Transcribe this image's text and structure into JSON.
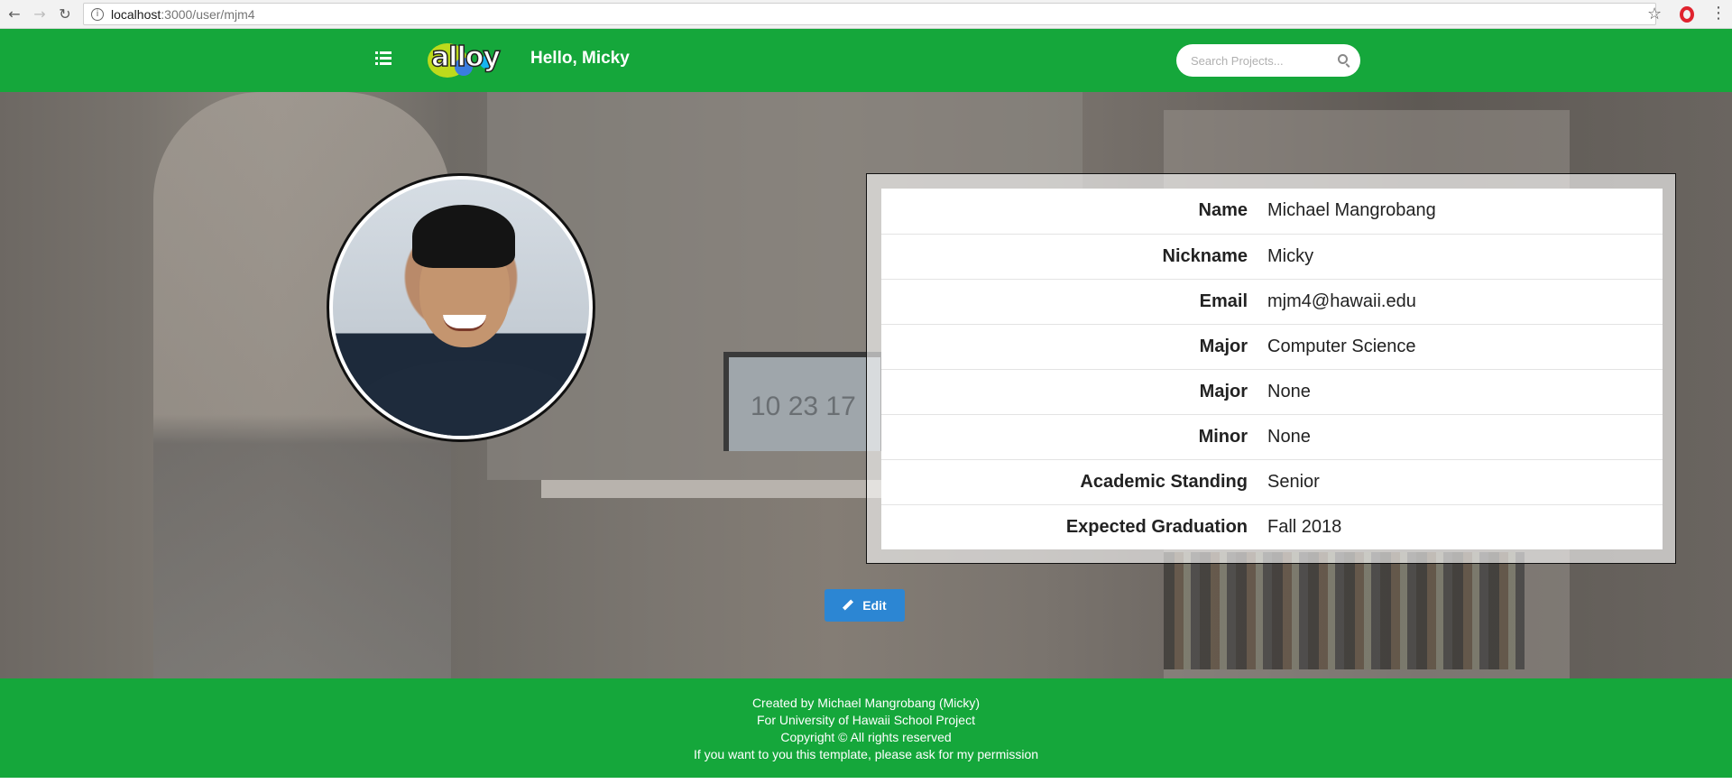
{
  "browser": {
    "url_host": "localhost",
    "url_path": ":3000/user/mjm4"
  },
  "header": {
    "logo_text": "alloy",
    "greeting": "Hello, Micky",
    "search_placeholder": "Search Projects..."
  },
  "background": {
    "clock_text": "10 23 17"
  },
  "profile": {
    "rows": [
      {
        "label": "Name",
        "value": "Michael Mangrobang"
      },
      {
        "label": "Nickname",
        "value": "Micky"
      },
      {
        "label": "Email",
        "value": "mjm4@hawaii.edu"
      },
      {
        "label": "Major",
        "value": "Computer Science"
      },
      {
        "label": "Major",
        "value": "None"
      },
      {
        "label": "Minor",
        "value": "None"
      },
      {
        "label": "Academic Standing",
        "value": "Senior"
      },
      {
        "label": "Expected Graduation",
        "value": "Fall 2018"
      }
    ],
    "edit_label": "Edit"
  },
  "footer": {
    "line1": "Created by Michael Mangrobang (Micky)",
    "line2": "For University of Hawaii School Project",
    "line3": "Copyright © All rights reserved",
    "line4": "If you want to you this template, please ask for my permission"
  },
  "colors": {
    "brand_green": "#15a73b",
    "edit_blue": "#2c86d3"
  },
  "icons": [
    "back-icon",
    "forward-icon",
    "reload-icon",
    "info-icon",
    "star-icon",
    "opera-icon",
    "menu-icon",
    "list-menu-icon",
    "search-icon",
    "pencil-icon"
  ]
}
